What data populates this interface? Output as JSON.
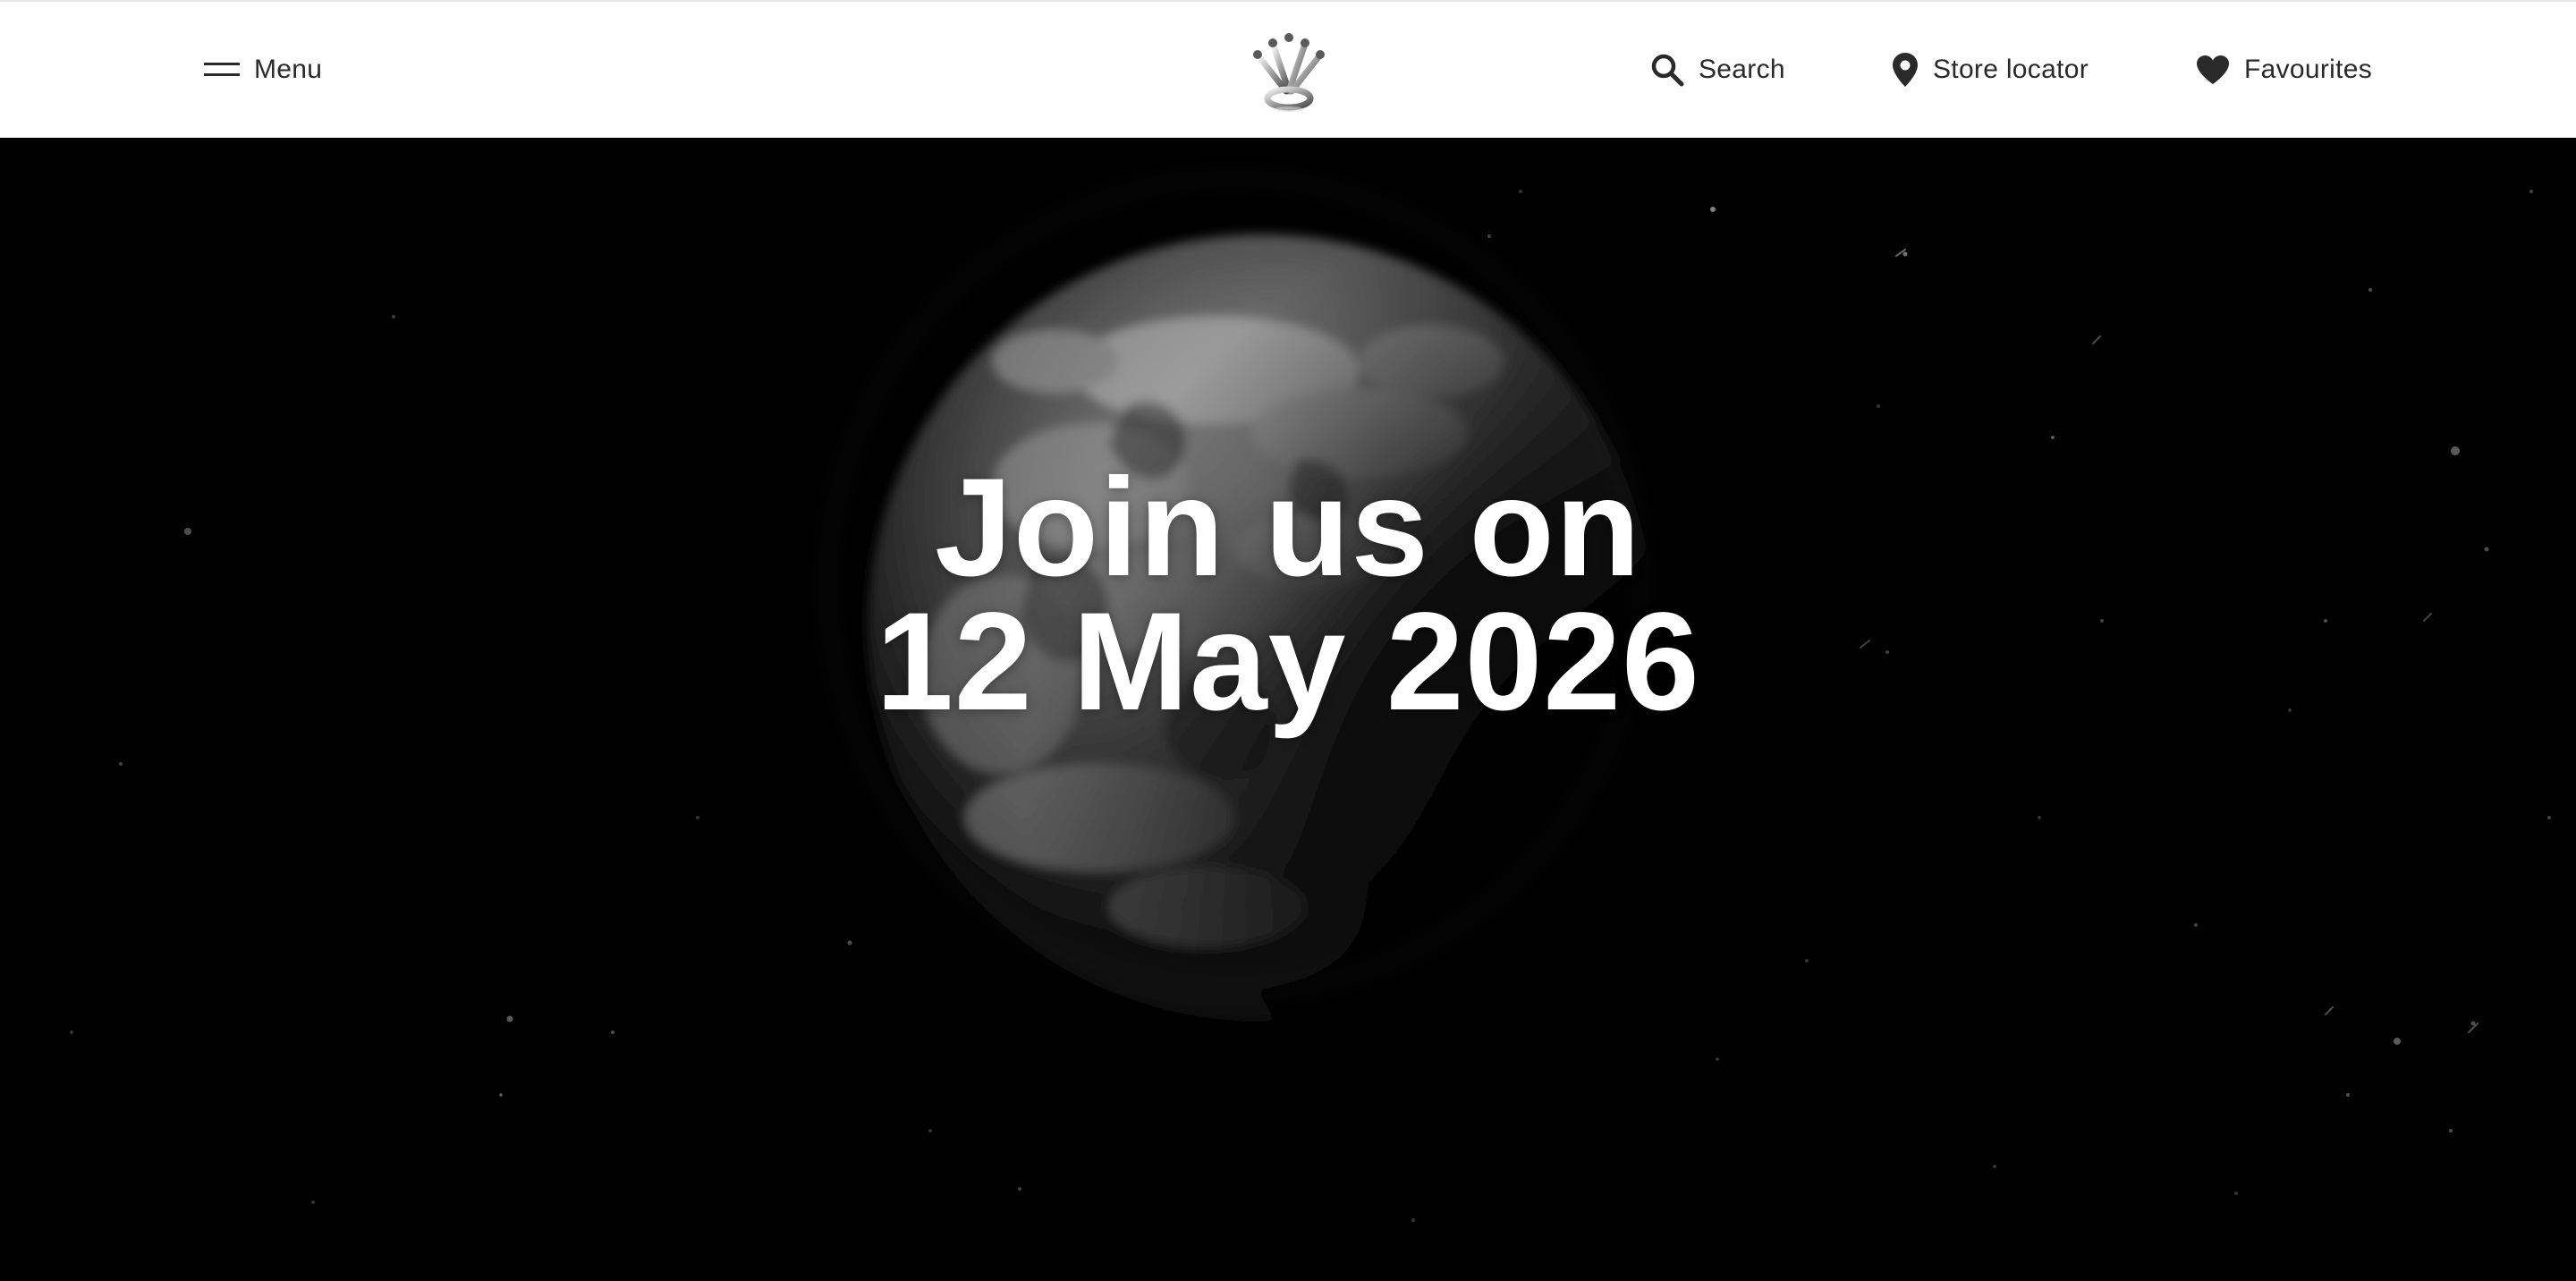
{
  "header": {
    "menu_label": "Menu",
    "search_label": "Search",
    "store_locator_label": "Store locator",
    "favourites_label": "Favourites",
    "text_color": "#2a2a2a",
    "icons": {
      "menu": "hamburger-icon",
      "search": "search-icon",
      "store_locator": "location-pin-icon",
      "favourites": "heart-icon",
      "logo": "crown-logo"
    }
  },
  "hero": {
    "headline_line1": "Join us on",
    "headline_line2": "12 May 2026",
    "background_color": "#000000",
    "text_color": "#ffffff"
  }
}
